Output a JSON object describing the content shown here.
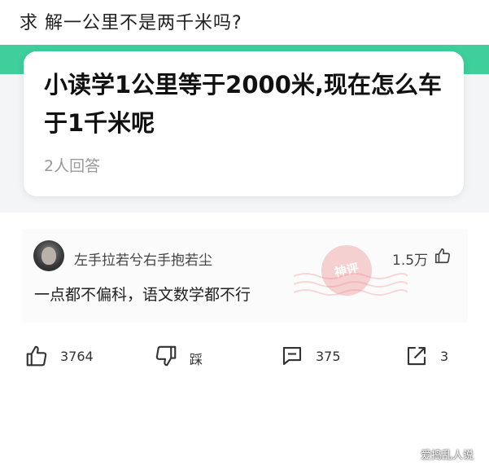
{
  "header": {
    "question_line": "求   解一公里不是两千米吗?"
  },
  "question_card": {
    "title": "小读学1公里等于2000米,现在怎么车于1千米呢",
    "answer_count": "2人回答"
  },
  "answer": {
    "username": "左手拉若兮右手抱若尘",
    "like_count": "1.5万",
    "text": "一点都不偏科，语文数学都不行",
    "stamp_text": "神评"
  },
  "actions": {
    "like": "3764",
    "dislike": "踩",
    "comment": "375",
    "share": "3"
  },
  "watermark": "爱捣乱人说",
  "colors": {
    "accent_green": "#3ecf9c",
    "stamp_red": "#ec8080"
  }
}
